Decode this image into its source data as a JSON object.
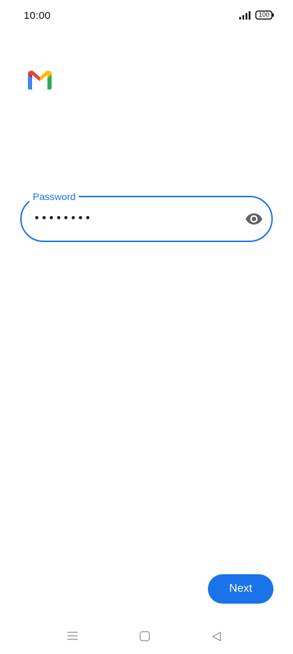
{
  "status_bar": {
    "time": "10:00",
    "signal_icon": "signal-bars-icon",
    "battery_icon": "battery-icon",
    "battery_level": "100"
  },
  "app": {
    "logo_icon": "gmail-logo"
  },
  "password_field": {
    "label": "Password",
    "value": "••••••••",
    "toggle_icon": "eye-icon"
  },
  "actions": {
    "next_label": "Next"
  },
  "navigation_bar": {
    "menu_icon": "menu-icon",
    "home_icon": "home-icon",
    "back_icon": "back-icon"
  },
  "colors": {
    "accent": "#1a73e8",
    "background": "#ffffff",
    "text": "#202124",
    "icon_gray": "#5f6368"
  }
}
